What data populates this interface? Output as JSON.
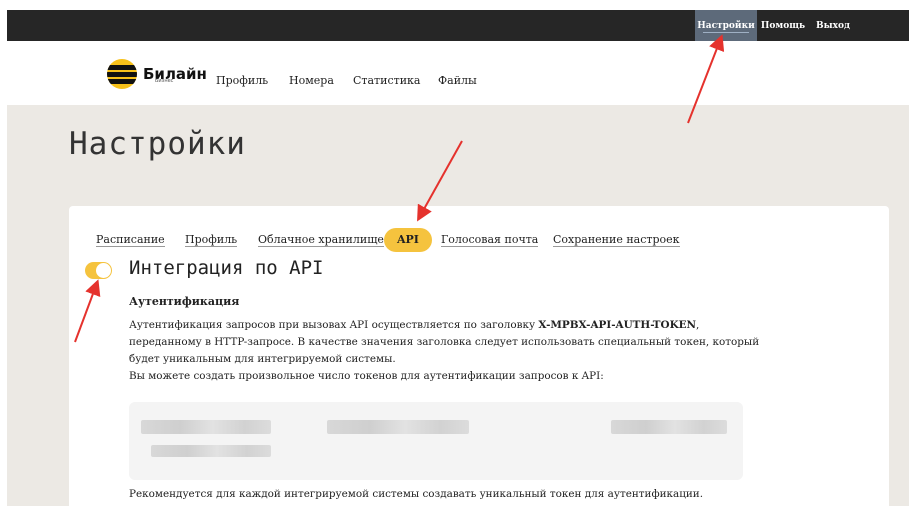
{
  "topbar": {
    "items": [
      "Настройки",
      "Помощь",
      "Выход"
    ]
  },
  "brand": {
    "name": "Билайн",
    "sub": "Бизнес"
  },
  "nav": {
    "items": [
      "Профиль",
      "Номера",
      "Статистика",
      "Файлы"
    ]
  },
  "page": {
    "title": "Настройки"
  },
  "tabs": [
    {
      "label": "Расписание"
    },
    {
      "label": "Профиль"
    },
    {
      "label": "Облачное хранилище"
    },
    {
      "label": "API"
    },
    {
      "label": "Голосовая почта"
    },
    {
      "label": "Сохранение настроек"
    }
  ],
  "api": {
    "enabled": true,
    "title": "Интеграция по API",
    "auth_title": "Аутентификация",
    "text_pre": "Аутентификация запросов при вызовах API осуществляется по заголовку ",
    "header_name": "X-MPBX-API-AUTH-TOKEN",
    "text_post": ", переданному в HTTP-запросе. В качестве значения заголовка следует использовать специальный токен, который будет уникальным для интегрируемой системы.",
    "tokens_note": "Вы можете создать произвольное число токенов для аутентификации запросов к API:",
    "recommend": "Рекомендуется для каждой интегрируемой системы создавать уникальный токен для аутентификации."
  },
  "colors": {
    "accent": "#f5c33e",
    "topbar": "#262626",
    "annotation": "#e5322d",
    "background": "#ece9e4"
  }
}
